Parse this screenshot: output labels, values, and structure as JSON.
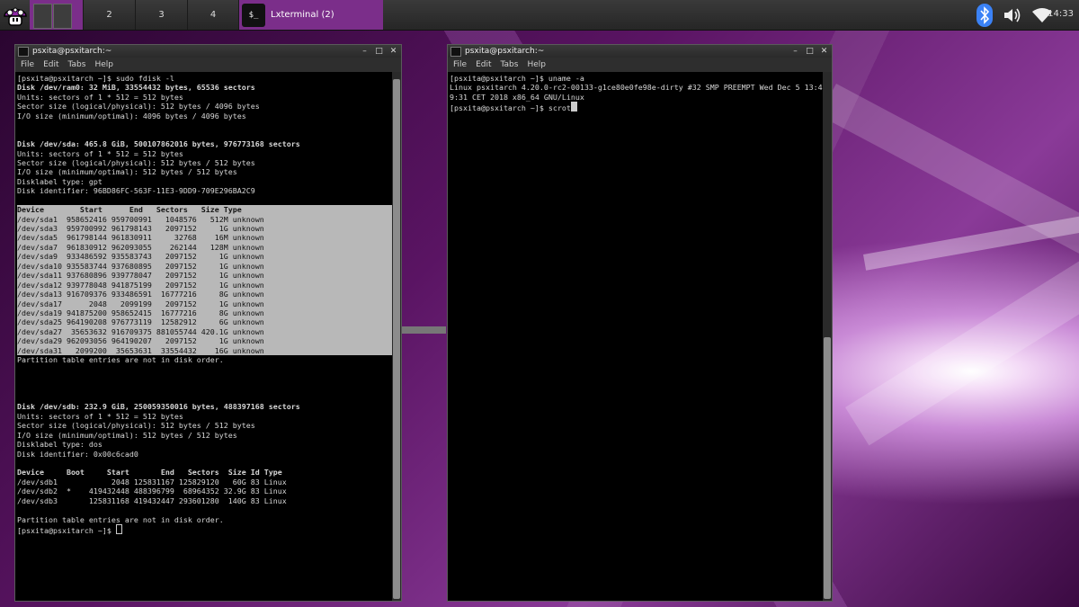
{
  "taskbar": {
    "workspaces": [
      {
        "label": ""
      },
      {
        "label": "2"
      },
      {
        "label": "3"
      },
      {
        "label": "4"
      }
    ],
    "task_title": "Lxterminal (2)",
    "task_icon": "$_",
    "clock": "14:33",
    "tray_icons": [
      "bluetooth-icon",
      "volume-icon",
      "wifi-icon"
    ]
  },
  "windows": {
    "left": {
      "title": "psxita@psxitarch:~",
      "menu": [
        "File",
        "Edit",
        "Tabs",
        "Help"
      ],
      "lines": [
        {
          "t": "[psxita@psxitarch ~]$ sudo fdisk -l",
          "c": ""
        },
        {
          "t": "Disk /dev/ram0: 32 MiB, 33554432 bytes, 65536 sectors",
          "c": "b"
        },
        {
          "t": "Units: sectors of 1 * 512 = 512 bytes",
          "c": ""
        },
        {
          "t": "Sector size (logical/physical): 512 bytes / 4096 bytes",
          "c": ""
        },
        {
          "t": "I/O size (minimum/optimal): 4096 bytes / 4096 bytes",
          "c": ""
        },
        {
          "t": "",
          "c": ""
        },
        {
          "t": "",
          "c": ""
        },
        {
          "t": "Disk /dev/sda: 465.8 GiB, 500107862016 bytes, 976773168 sectors",
          "c": "b"
        },
        {
          "t": "Units: sectors of 1 * 512 = 512 bytes",
          "c": ""
        },
        {
          "t": "Sector size (logical/physical): 512 bytes / 512 bytes",
          "c": ""
        },
        {
          "t": "I/O size (minimum/optimal): 512 bytes / 512 bytes",
          "c": ""
        },
        {
          "t": "Disklabel type: gpt",
          "c": ""
        },
        {
          "t": "Disk identifier: 96BD86FC-563F-11E3-9DD9-709E296BA2C9",
          "c": ""
        },
        {
          "t": "",
          "c": ""
        },
        {
          "t": "Device        Start      End   Sectors   Size Type",
          "c": "sel b"
        },
        {
          "t": "/dev/sda1  958652416 959700991   1048576   512M unknown",
          "c": "sel"
        },
        {
          "t": "/dev/sda3  959700992 961798143   2097152     1G unknown",
          "c": "sel"
        },
        {
          "t": "/dev/sda5  961798144 961830911     32768    16M unknown",
          "c": "sel"
        },
        {
          "t": "/dev/sda7  961830912 962093055    262144   128M unknown",
          "c": "sel"
        },
        {
          "t": "/dev/sda9  933486592 935583743   2097152     1G unknown",
          "c": "sel"
        },
        {
          "t": "/dev/sda10 935583744 937680895   2097152     1G unknown",
          "c": "sel"
        },
        {
          "t": "/dev/sda11 937680896 939778047   2097152     1G unknown",
          "c": "sel"
        },
        {
          "t": "/dev/sda12 939778048 941875199   2097152     1G unknown",
          "c": "sel"
        },
        {
          "t": "/dev/sda13 916709376 933486591  16777216     8G unknown",
          "c": "sel"
        },
        {
          "t": "/dev/sda17      2048   2099199   2097152     1G unknown",
          "c": "sel"
        },
        {
          "t": "/dev/sda19 941875200 958652415  16777216     8G unknown",
          "c": "sel"
        },
        {
          "t": "/dev/sda25 964190208 976773119  12582912     6G unknown",
          "c": "sel"
        },
        {
          "t": "/dev/sda27  35653632 916709375 881055744 420.1G unknown",
          "c": "sel"
        },
        {
          "t": "/dev/sda29 962093056 964190207   2097152     1G unknown",
          "c": "sel"
        },
        {
          "t": "/dev/sda31   2099200  35653631  33554432    16G unknown",
          "c": "sel"
        },
        {
          "t": "Partition table entries are not in disk order.",
          "c": ""
        },
        {
          "t": "",
          "c": ""
        },
        {
          "t": "",
          "c": ""
        },
        {
          "t": "",
          "c": ""
        },
        {
          "t": "",
          "c": ""
        },
        {
          "t": "Disk /dev/sdb: 232.9 GiB, 250059350016 bytes, 488397168 sectors",
          "c": "b"
        },
        {
          "t": "Units: sectors of 1 * 512 = 512 bytes",
          "c": ""
        },
        {
          "t": "Sector size (logical/physical): 512 bytes / 512 bytes",
          "c": ""
        },
        {
          "t": "I/O size (minimum/optimal): 512 bytes / 512 bytes",
          "c": ""
        },
        {
          "t": "Disklabel type: dos",
          "c": ""
        },
        {
          "t": "Disk identifier: 0x00c6cad0",
          "c": ""
        },
        {
          "t": "",
          "c": ""
        },
        {
          "t": "Device     Boot     Start       End   Sectors  Size Id Type",
          "c": "b"
        },
        {
          "t": "/dev/sdb1            2048 125831167 125829120   60G 83 Linux",
          "c": ""
        },
        {
          "t": "/dev/sdb2  *    419432448 488396799  68964352 32.9G 83 Linux",
          "c": ""
        },
        {
          "t": "/dev/sdb3       125831168 419432447 293601280  140G 83 Linux",
          "c": ""
        },
        {
          "t": "",
          "c": ""
        },
        {
          "t": "Partition table entries are not in disk order.",
          "c": ""
        }
      ],
      "prompt": "[psxita@psxitarch ~]$ "
    },
    "right": {
      "title": "psxita@psxitarch:~",
      "menu": [
        "File",
        "Edit",
        "Tabs",
        "Help"
      ],
      "lines": [
        {
          "t": "[psxita@psxitarch ~]$ uname -a",
          "c": ""
        },
        {
          "t": "Linux psxitarch 4.20.0-rc2-00133-g1ce80e0fe98e-dirty #32 SMP PREEMPT Wed Dec 5 13:4",
          "c": ""
        },
        {
          "t": "9:31 CET 2018 x86_64 GNU/Linux",
          "c": ""
        }
      ],
      "prompt": "[psxita@psxitarch ~]$ scrot"
    }
  },
  "colors": {
    "accent": "#7b2e8a",
    "selection": "#b8b8b8",
    "terminal_bg": "#000000",
    "terminal_fg": "#d8d8d8",
    "bluetooth": "#3b82f6"
  }
}
